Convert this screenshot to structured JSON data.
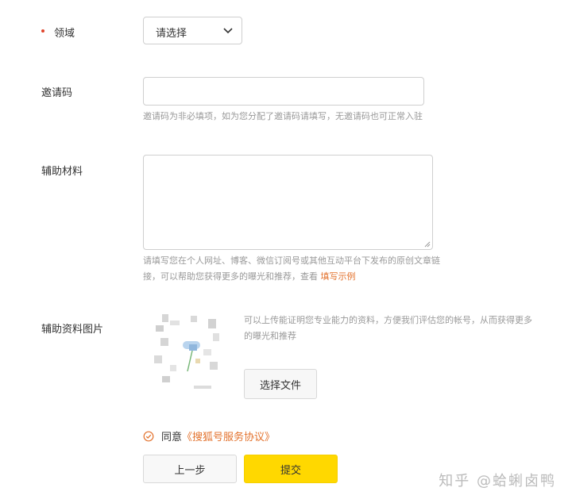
{
  "domain_field": {
    "label": "领域",
    "select_value": "请选择"
  },
  "invite_field": {
    "label": "邀请码",
    "hint": "邀请码为非必填项，如为您分配了邀请码请填写，无邀请码也可正常入驻"
  },
  "materials_field": {
    "label": "辅助材料",
    "hint_line1": "请填写您在个人网址、博客、微信订阅号或其他互动平台下发布的原创文章链",
    "hint_line2": "接，可以帮助您获得更多的曝光和推荐，查看",
    "hint_link": "填写示例"
  },
  "image_field": {
    "label": "辅助资料图片",
    "hint_line1": "可以上传能证明您专业能力的资料，方便我们评估您的帐号，从而获得更多",
    "hint_line2": "的曝光和推荐",
    "file_button": "选择文件"
  },
  "agreement": {
    "prefix": "同意",
    "link": "《搜狐号服务协议》"
  },
  "buttons": {
    "prev": "上一步",
    "submit": "提交"
  },
  "watermark": "知乎 @蛤蜊卤鸭",
  "colors": {
    "accent": "#e3722d",
    "submit": "#ffd800",
    "required": "#e0442b"
  }
}
